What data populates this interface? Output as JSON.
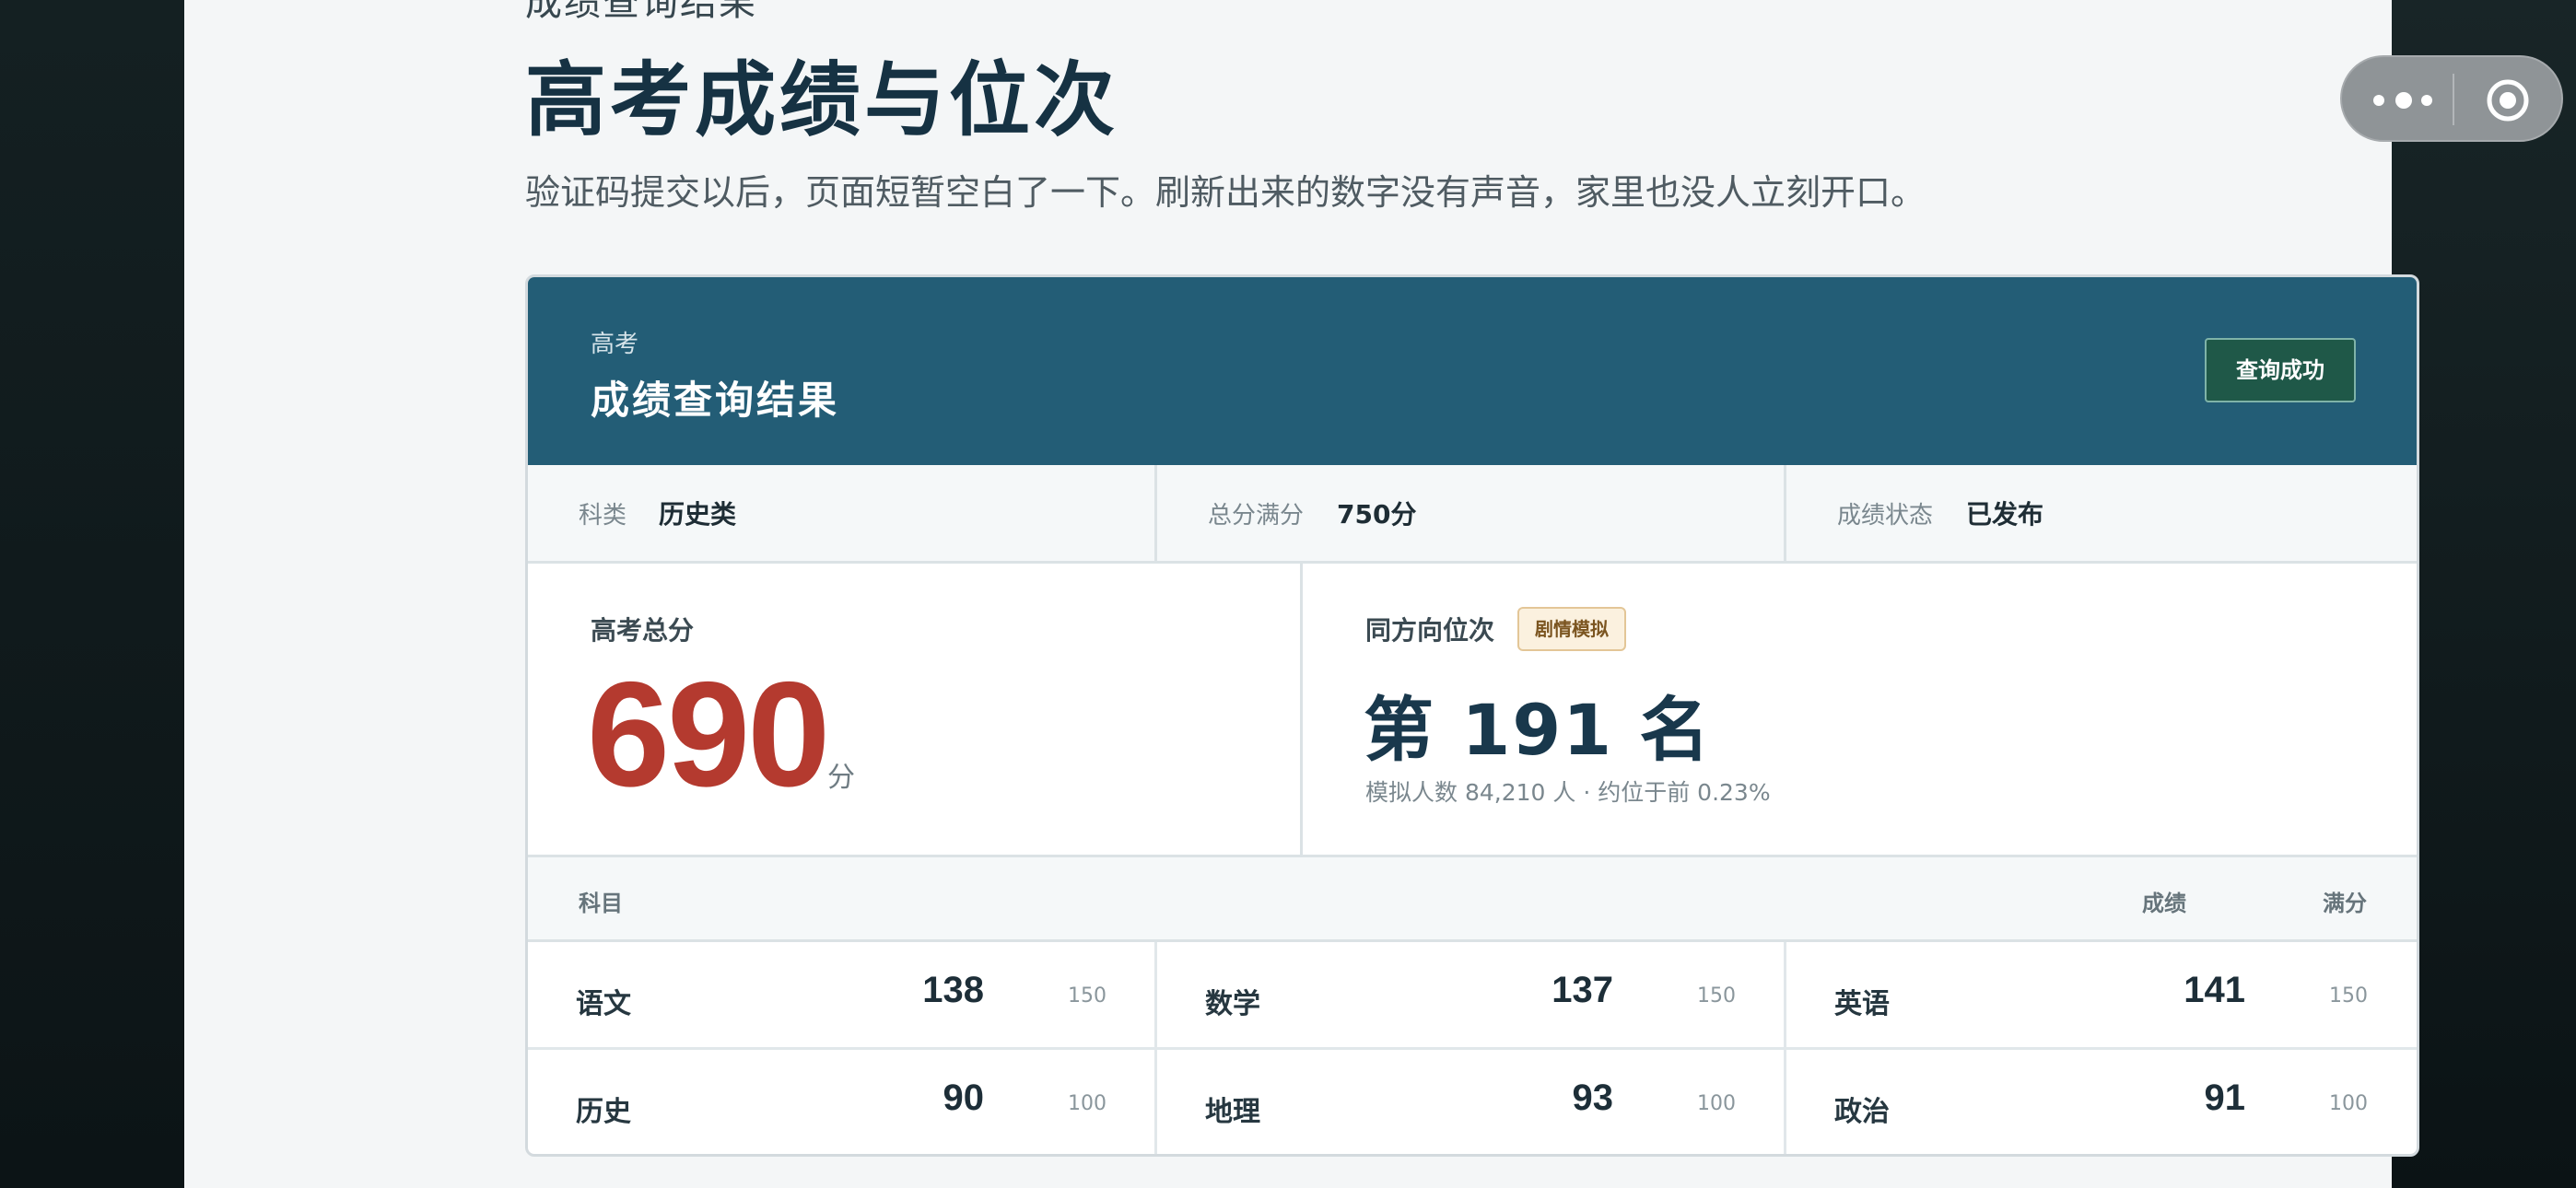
{
  "page": {
    "cut_off_text": "成绩查询结果",
    "title": "高考成绩与位次",
    "subtitle": "验证码提交以后，页面短暂空白了一下。刷新出来的数字没有声音，家里也没人立刻开口。"
  },
  "capsule": {
    "more_icon": "dots-icon",
    "close_icon": "target-circle-icon"
  },
  "card": {
    "header": {
      "small": "高考",
      "title": "成绩查询结果",
      "badge": "查询成功"
    },
    "info": [
      {
        "label": "科类",
        "value": "历史类"
      },
      {
        "label": "总分满分",
        "value": "750分"
      },
      {
        "label": "成绩状态",
        "value": "已发布"
      }
    ],
    "score": {
      "label": "高考总分",
      "value": "690",
      "unit": "分"
    },
    "rank": {
      "label": "同方向位次",
      "tag": "剧情模拟",
      "text": "第 191 名",
      "note": "模拟人数 84,210 人 · 约位于前 0.23%"
    },
    "subjects_header": {
      "subject": "科目",
      "score": "成绩",
      "full": "满分"
    },
    "subjects": [
      [
        {
          "name": "语文",
          "score": "138",
          "full": "150"
        },
        {
          "name": "数学",
          "score": "137",
          "full": "150"
        },
        {
          "name": "英语",
          "score": "141",
          "full": "150"
        }
      ],
      [
        {
          "name": "历史",
          "score": "90",
          "full": "100"
        },
        {
          "name": "地理",
          "score": "93",
          "full": "100"
        },
        {
          "name": "政治",
          "score": "91",
          "full": "100"
        }
      ]
    ]
  }
}
